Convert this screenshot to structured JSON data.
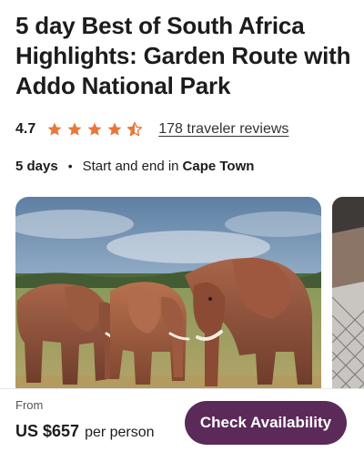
{
  "tour": {
    "title": "5 day Best of South Africa Highlights: Garden Route with Addo National Park",
    "rating": "4.7",
    "rating_value": 4.5,
    "stars_total": 5,
    "reviews_link": "178 traveler reviews",
    "duration": "5 days",
    "separator": "•",
    "start_end_prefix": "Start and end in",
    "start_end_city": "Cape Town"
  },
  "gallery": {
    "main_image": "elephants-photo",
    "next_image": "rocks-and-net-photo"
  },
  "booking": {
    "from_label": "From",
    "price": "US $657",
    "price_unit": "per person",
    "cta_label": "Check Availability"
  },
  "colors": {
    "star": "#e8773a",
    "cta": "#5b2a59"
  }
}
